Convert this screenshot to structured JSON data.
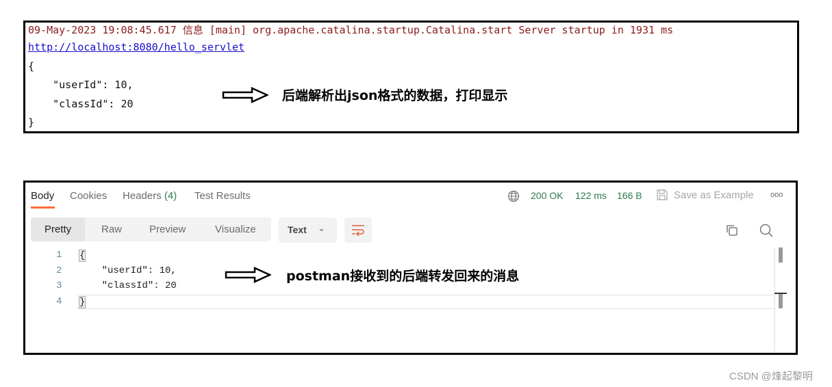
{
  "console": {
    "log_line": "09-May-2023 19:08:45.617 信息 [main] org.apache.catalina.startup.Catalina.start Server startup in 1931 ms",
    "url": "http://localhost:8080/hello_servlet",
    "json_lines": [
      "{",
      "    \"userId\": 10,",
      "    \"classId\": 20",
      "}"
    ],
    "annotation": "后端解析出json格式的数据，打印显示"
  },
  "postman": {
    "tabs": [
      {
        "label": "Body",
        "active": true
      },
      {
        "label": "Cookies"
      },
      {
        "label": "Headers",
        "count": "(4)"
      },
      {
        "label": "Test Results"
      }
    ],
    "status": "200 OK",
    "time": "122 ms",
    "size": "166 B",
    "save_label": "Save as Example",
    "more_label": "ooo",
    "view_modes": [
      "Pretty",
      "Raw",
      "Preview",
      "Visualize"
    ],
    "active_view": "Pretty",
    "format_select": "Text",
    "code_lines": [
      {
        "n": "1",
        "text": "{"
      },
      {
        "n": "2",
        "text": "    \"userId\": 10,"
      },
      {
        "n": "3",
        "text": "    \"classId\": 20"
      },
      {
        "n": "4",
        "text": "}"
      }
    ],
    "annotation": "postman接收到的后端转发回来的消息",
    "colors": {
      "accent": "#ff6c37",
      "status_green": "#2b7a4b"
    }
  },
  "watermark": "CSDN @烽起黎明"
}
